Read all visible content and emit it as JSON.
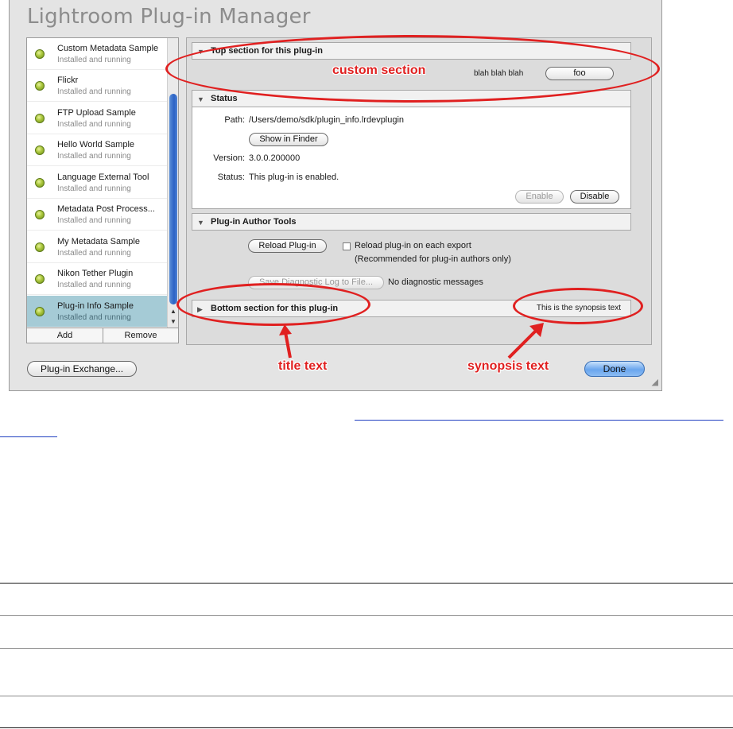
{
  "window": {
    "title": "Lightroom Plug-in Manager"
  },
  "plugins": [
    {
      "name": "Custom Metadata Sample",
      "status": "Installed and running"
    },
    {
      "name": "Flickr",
      "status": "Installed and running"
    },
    {
      "name": "FTP Upload Sample",
      "status": "Installed and running"
    },
    {
      "name": "Hello World Sample",
      "status": "Installed and running"
    },
    {
      "name": "Language External Tool",
      "status": "Installed and running"
    },
    {
      "name": "Metadata Post Process...",
      "status": "Installed and running"
    },
    {
      "name": "My Metadata Sample",
      "status": "Installed and running"
    },
    {
      "name": "Nikon Tether Plugin",
      "status": "Installed and running"
    },
    {
      "name": "Plug-in Info Sample",
      "status": "Installed and running"
    }
  ],
  "list_buttons": {
    "add": "Add",
    "remove": "Remove"
  },
  "top_section": {
    "title": "Top section for this plug-in",
    "label": "blah blah blah",
    "button": "foo"
  },
  "status_section": {
    "title": "Status",
    "path_label": "Path:",
    "path_value": "/Users/demo/sdk/plugin_info.lrdevplugin",
    "show_in_finder": "Show in Finder",
    "version_label": "Version:",
    "version_value": "3.0.0.200000",
    "status_label": "Status:",
    "status_value": "This plug-in is enabled.",
    "enable": "Enable",
    "disable": "Disable"
  },
  "author_tools": {
    "title": "Plug-in Author Tools",
    "reload": "Reload Plug-in",
    "reload_each_export": "Reload plug-in on each export",
    "recommended": "(Recommended for plug-in authors only)",
    "save_log": "Save Diagnostic Log to File...",
    "no_messages": "No diagnostic messages"
  },
  "bottom_section": {
    "title": "Bottom section for this plug-in",
    "synopsis": "This is the synopsis text"
  },
  "footer": {
    "exchange": "Plug-in Exchange...",
    "done": "Done"
  },
  "annotations": {
    "custom_section": "custom section",
    "title_text": "title text",
    "synopsis_text": "synopsis text"
  },
  "colors": {
    "annotation": "#e02020",
    "selection": "#a5cbd6",
    "done_button": "#6aa6ee"
  }
}
